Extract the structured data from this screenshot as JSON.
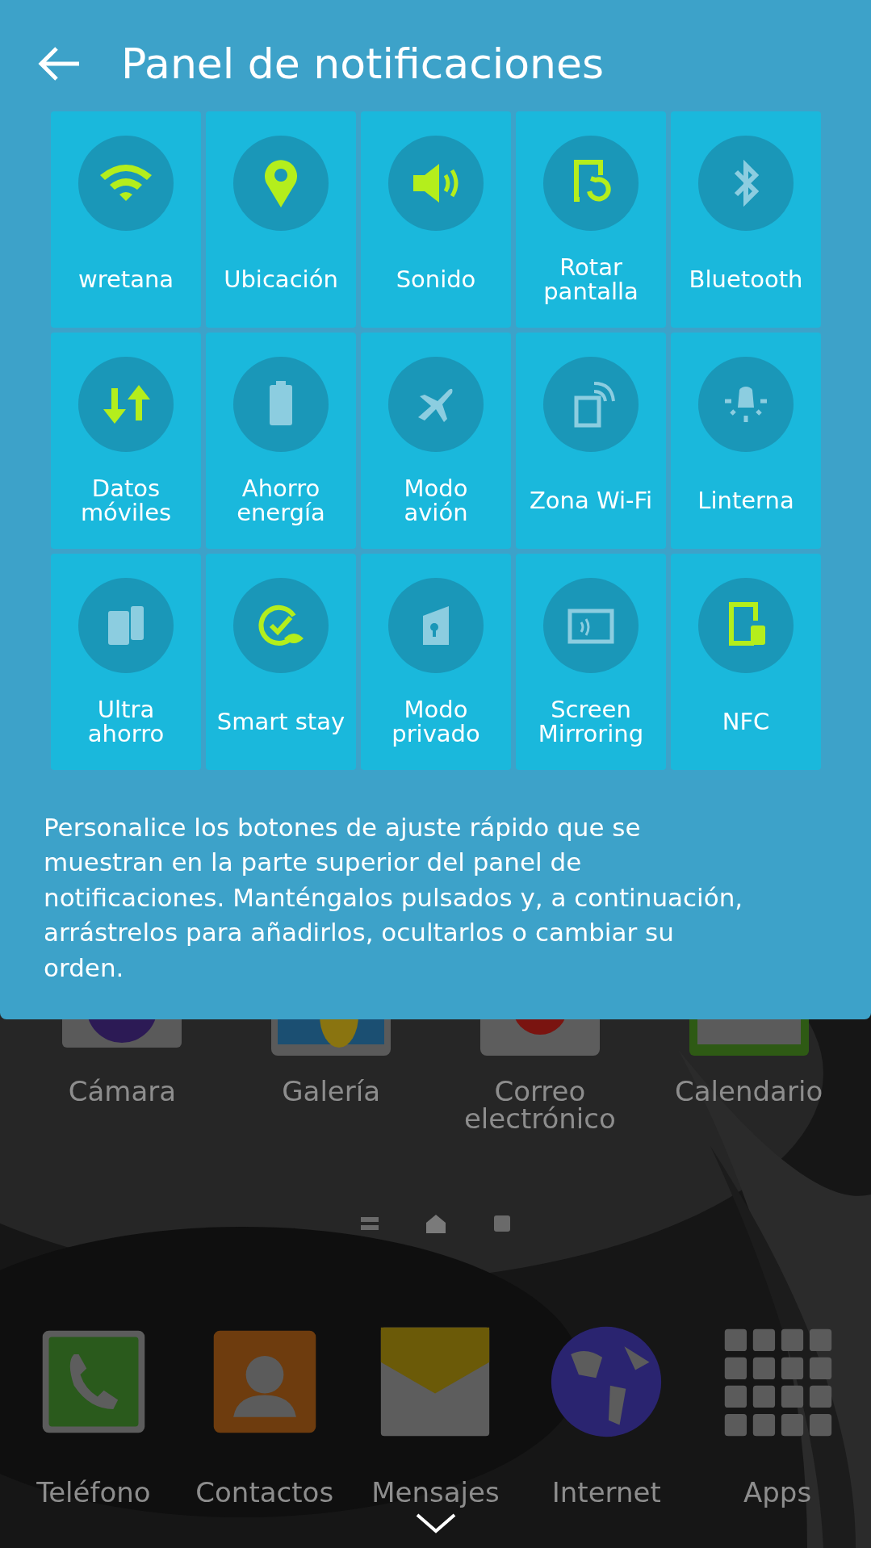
{
  "header": {
    "title": "Panel de notificaciones"
  },
  "tiles": [
    {
      "label": "wretana",
      "on": true
    },
    {
      "label": "Ubicación",
      "on": true
    },
    {
      "label": "Sonido",
      "on": true
    },
    {
      "label": "Rotar pantalla",
      "on": true
    },
    {
      "label": "Bluetooth",
      "on": false
    },
    {
      "label": "Datos móviles",
      "on": true
    },
    {
      "label": "Ahorro energía",
      "on": false
    },
    {
      "label": "Modo avión",
      "on": false
    },
    {
      "label": "Zona Wi-Fi",
      "on": false
    },
    {
      "label": "Linterna",
      "on": false
    },
    {
      "label": "Ultra ahorro",
      "on": false
    },
    {
      "label": "Smart stay",
      "on": true
    },
    {
      "label": "Modo privado",
      "on": false
    },
    {
      "label": "Screen Mirroring",
      "on": false
    },
    {
      "label": "NFC",
      "on": true
    }
  ],
  "description": "Personalice los botones de ajuste rápido que se muestran en la parte superior del panel de notificaciones. Manténgalos pulsados y, a continuación, arrástrelos para añadirlos, ocultarlos o cambiar su orden.",
  "home": {
    "apps": [
      {
        "label": "Cámara"
      },
      {
        "label": "Galería"
      },
      {
        "label": "Correo electrónico"
      },
      {
        "label": "Calendario"
      }
    ],
    "dock": [
      {
        "label": "Teléfono"
      },
      {
        "label": "Contactos"
      },
      {
        "label": "Mensajes"
      },
      {
        "label": "Internet"
      },
      {
        "label": "Apps"
      }
    ]
  }
}
